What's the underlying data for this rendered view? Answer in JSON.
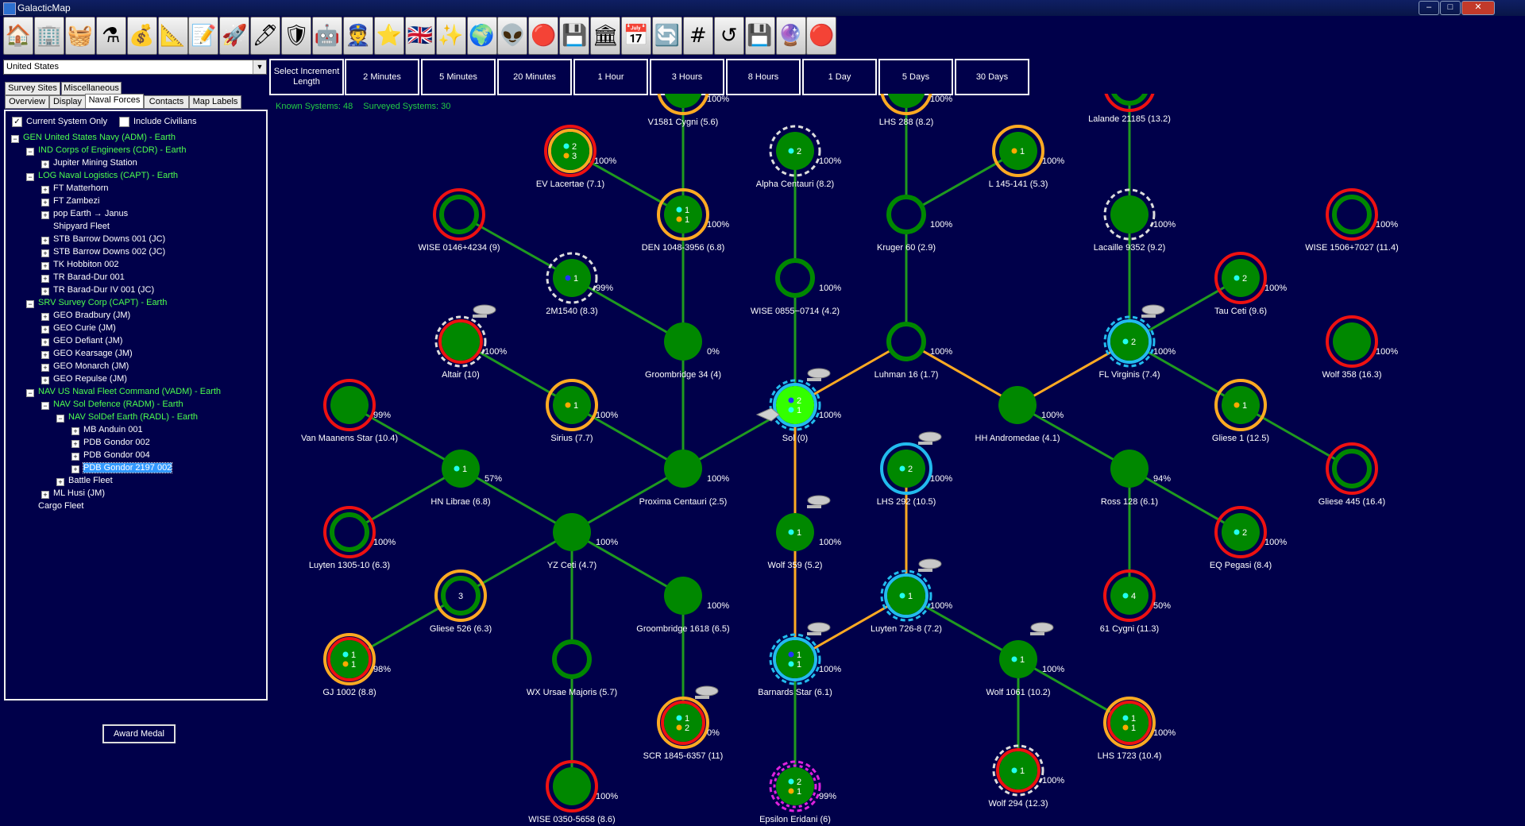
{
  "app": {
    "title": "GalacticMap"
  },
  "toolbar": [
    {
      "icon": "house-icon",
      "glyph": "🏠"
    },
    {
      "icon": "buildings-icon",
      "glyph": "🏢"
    },
    {
      "icon": "cargo-icon",
      "glyph": "🧺"
    },
    {
      "icon": "flask-icon",
      "glyph": "⚗"
    },
    {
      "icon": "money-bag-icon",
      "glyph": "💰"
    },
    {
      "icon": "blueprint-icon",
      "glyph": "📐"
    },
    {
      "icon": "document-icon",
      "glyph": "📝"
    },
    {
      "icon": "starship-icon",
      "glyph": "🚀"
    },
    {
      "icon": "missile-icon",
      "glyph": "🖊"
    },
    {
      "icon": "tank-icon",
      "glyph": "🛡"
    },
    {
      "icon": "walker-icon",
      "glyph": "🤖"
    },
    {
      "icon": "officer-icon",
      "glyph": "👮"
    },
    {
      "icon": "star-medal-icon",
      "glyph": "⭐"
    },
    {
      "icon": "union-jack-icon",
      "glyph": "🇬🇧"
    },
    {
      "icon": "system-map-icon",
      "glyph": "✨"
    },
    {
      "icon": "globe-icon",
      "glyph": "🌍"
    },
    {
      "icon": "alien-icon",
      "glyph": "👽"
    },
    {
      "icon": "red-eye-icon",
      "glyph": "🔴"
    },
    {
      "icon": "circuit-icon",
      "glyph": "💾"
    },
    {
      "icon": "capitol-icon",
      "glyph": "🏛"
    },
    {
      "icon": "calendar-icon",
      "glyph": "📅"
    },
    {
      "icon": "refresh-icon",
      "glyph": "🔄"
    },
    {
      "icon": "grid-icon",
      "glyph": "#"
    },
    {
      "icon": "undo-arrow-icon",
      "glyph": "↺"
    },
    {
      "icon": "save-icon",
      "glyph": "💾"
    },
    {
      "icon": "crystal-ball-icon",
      "glyph": "🔮"
    },
    {
      "icon": "red-button-icon",
      "glyph": "🔴"
    }
  ],
  "empire_select": {
    "value": "United States"
  },
  "tabs_row1": [
    "Survey Sites",
    "Miscellaneous"
  ],
  "tabs_row2": [
    "Overview",
    "Display",
    "Naval Forces",
    "Contacts",
    "Map Labels"
  ],
  "active_tab": "Naval Forces",
  "checkboxes": {
    "current_system_only": "Current System Only",
    "current_checked": "✓",
    "include_civilians": "Include Civilians"
  },
  "tree": [
    {
      "level": 0,
      "tog": "−",
      "text": "GEN United States Navy  (ADM)  -  Earth",
      "color": "#4dff4d"
    },
    {
      "level": 1,
      "tog": "−",
      "text": "IND Corps of Engineers  (CDR)  -  Earth",
      "color": "#4dff4d"
    },
    {
      "level": 2,
      "tog": "+",
      "text": "Jupiter Mining Station",
      "color": "#ffffff"
    },
    {
      "level": 1,
      "tog": "−",
      "text": "LOG Naval Logistics  (CAPT)  -  Earth",
      "color": "#4dff4d"
    },
    {
      "level": 2,
      "tog": "+",
      "text": "FT Matterhorn",
      "color": "#ffffff"
    },
    {
      "level": 2,
      "tog": "+",
      "text": "FT Zambezi",
      "color": "#ffffff"
    },
    {
      "level": 2,
      "tog": "+",
      "text": "pop Earth → Janus",
      "color": "#ffffff"
    },
    {
      "level": 2,
      "tog": "",
      "text": "Shipyard Fleet",
      "color": "#ffffff"
    },
    {
      "level": 2,
      "tog": "+",
      "text": "STB Barrow Downs 001  (JC)",
      "color": "#ffffff"
    },
    {
      "level": 2,
      "tog": "+",
      "text": "STB Barrow Downs 002  (JC)",
      "color": "#ffffff"
    },
    {
      "level": 2,
      "tog": "+",
      "text": "TK Hobbiton 002",
      "color": "#ffffff"
    },
    {
      "level": 2,
      "tog": "+",
      "text": "TR Barad-Dur 001",
      "color": "#ffffff"
    },
    {
      "level": 2,
      "tog": "+",
      "text": "TR Barad-Dur IV 001  (JC)",
      "color": "#ffffff"
    },
    {
      "level": 1,
      "tog": "−",
      "text": "SRV Survey Corp  (CAPT)  -  Earth",
      "color": "#4dff4d"
    },
    {
      "level": 2,
      "tog": "+",
      "text": "GEO Bradbury  (JM)",
      "color": "#ffffff"
    },
    {
      "level": 2,
      "tog": "+",
      "text": "GEO Curie  (JM)",
      "color": "#ffffff"
    },
    {
      "level": 2,
      "tog": "+",
      "text": "GEO Defiant  (JM)",
      "color": "#ffffff"
    },
    {
      "level": 2,
      "tog": "+",
      "text": "GEO Kearsage  (JM)",
      "color": "#ffffff"
    },
    {
      "level": 2,
      "tog": "+",
      "text": "GEO Monarch  (JM)",
      "color": "#ffffff"
    },
    {
      "level": 2,
      "tog": "+",
      "text": "GEO Repulse  (JM)",
      "color": "#ffffff"
    },
    {
      "level": 1,
      "tog": "−",
      "text": "NAV US Naval Fleet Command  (VADM)  -  Earth",
      "color": "#4dff4d"
    },
    {
      "level": 2,
      "tog": "−",
      "text": "NAV Sol Defence  (RADM)  -  Earth",
      "color": "#4dff4d"
    },
    {
      "level": 3,
      "tog": "−",
      "text": "NAV SolDef Earth  (RADL)  -  Earth",
      "color": "#4dff4d"
    },
    {
      "level": 4,
      "tog": "+",
      "text": "MB Anduin 001",
      "color": "#ffffff"
    },
    {
      "level": 4,
      "tog": "+",
      "text": "PDB Gondor 002",
      "color": "#ffffff"
    },
    {
      "level": 4,
      "tog": "+",
      "text": "PDB Gondor 004",
      "color": "#ffffff"
    },
    {
      "level": 4,
      "tog": "+",
      "text": "PDB Gondor 2197 002",
      "color": "#ffffff",
      "selected": true
    },
    {
      "level": 3,
      "tog": "+",
      "text": "Battle Fleet",
      "color": "#ffffff"
    },
    {
      "level": 2,
      "tog": "+",
      "text": "ML Husi  (JM)",
      "color": "#ffffff"
    },
    {
      "level": 1,
      "tog": "",
      "text": "Cargo Fleet",
      "color": "#ffffff"
    }
  ],
  "award_button": "Award Medal",
  "increments": [
    "Select Increment Length",
    "2 Minutes",
    "5 Minutes",
    "20 Minutes",
    "1 Hour",
    "3 Hours",
    "8 Hours",
    "1 Day",
    "5 Days",
    "30 Days"
  ],
  "stats": {
    "known": "Known Systems: 48",
    "surveyed": "Surveyed Systems: 30"
  },
  "colors": {
    "lane_green": "#1f9a1f",
    "lane_orange": "#ffaa22",
    "ring_red": "#ee1111",
    "ring_orange": "#ffaa22",
    "ring_white": "#dddddd",
    "ring_cyan": "#22bbee",
    "ring_magenta": "#dd22dd",
    "planet": "#008800"
  },
  "systems": [
    {
      "id": "v1581",
      "name": "V1581 Cygni  (5.6)",
      "pct": "100%",
      "ring": [
        "orange"
      ],
      "fill": true
    },
    {
      "id": "lhs288",
      "name": "LHS 288  (8.2)",
      "pct": "100%",
      "ring": [
        "orange"
      ],
      "fill": true
    },
    {
      "id": "lalande",
      "name": "Lalande 21185  (13.2)",
      "pct": "",
      "ring": [
        "red"
      ],
      "fill": false
    },
    {
      "id": "evlac",
      "name": "EV Lacertae  (7.1)",
      "pct": "100%",
      "ring": [
        "red",
        "orange"
      ],
      "fill": true,
      "dots": [
        {
          "c": "cyan",
          "n": "2"
        },
        {
          "c": "orange",
          "n": "3"
        }
      ]
    },
    {
      "id": "alphacen",
      "name": "Alpha Centauri  (8.2)",
      "pct": "100%",
      "ring": [
        "whitedash"
      ],
      "fill": true,
      "dots": [
        {
          "c": "cyan",
          "n": "2"
        }
      ]
    },
    {
      "id": "l145",
      "name": "L 145-141  (5.3)",
      "pct": "100%",
      "ring": [
        "orange"
      ],
      "fill": true,
      "dots": [
        {
          "c": "orange",
          "n": "1"
        }
      ]
    },
    {
      "id": "wise0146",
      "name": "WISE 0146+4234  (9)",
      "pct": "",
      "ring": [
        "red"
      ],
      "fill": false
    },
    {
      "id": "den1048",
      "name": "DEN 1048-3956  (6.8)",
      "pct": "100%",
      "ring": [
        "orange"
      ],
      "fill": true,
      "dots": [
        {
          "c": "cyan",
          "n": "1"
        },
        {
          "c": "orange",
          "n": "1"
        }
      ]
    },
    {
      "id": "kruger60",
      "name": "Kruger 60  (2.9)",
      "pct": "100%",
      "ring": [],
      "fill": false
    },
    {
      "id": "lacaille",
      "name": "Lacaille 9352  (9.2)",
      "pct": "100%",
      "ring": [
        "whitedash"
      ],
      "fill": true
    },
    {
      "id": "wise1506",
      "name": "WISE 1506+7027  (11.4)",
      "pct": "100%",
      "ring": [
        "red"
      ],
      "fill": false
    },
    {
      "id": "2m1540",
      "name": "2M1540  (8.3)",
      "pct": "99%",
      "ring": [
        "whitedash"
      ],
      "fill": true,
      "dots": [
        {
          "c": "blue",
          "n": "1"
        }
      ]
    },
    {
      "id": "wise0855",
      "name": "WISE 0855−0714  (4.2)",
      "pct": "100%",
      "ring": [],
      "fill": false
    },
    {
      "id": "tauceti",
      "name": "Tau Ceti  (9.6)",
      "pct": "100%",
      "ring": [
        "red"
      ],
      "fill": true,
      "dots": [
        {
          "c": "cyan",
          "n": "2"
        }
      ]
    },
    {
      "id": "altair",
      "name": "Altair  (10)",
      "pct": "100%",
      "ring": [
        "whitedash",
        "red"
      ],
      "fill": true,
      "ship": true
    },
    {
      "id": "groom34",
      "name": "Groombridge 34  (4)",
      "pct": "0%",
      "ring": [],
      "fill": true
    },
    {
      "id": "luhman16",
      "name": "Luhman 16  (1.7)",
      "pct": "100%",
      "ring": [],
      "fill": false
    },
    {
      "id": "flvirg",
      "name": "FL Virginis  (7.4)",
      "pct": "100%",
      "ring": [
        "cyandash",
        "cyan"
      ],
      "fill": true,
      "dots": [
        {
          "c": "cyan",
          "n": "2"
        }
      ],
      "ship": true
    },
    {
      "id": "wolf358",
      "name": "Wolf 358  (16.3)",
      "pct": "100%",
      "ring": [
        "red"
      ],
      "fill": true
    },
    {
      "id": "vanmaanen",
      "name": "Van Maanens Star  (10.4)",
      "pct": "99%",
      "ring": [
        "red"
      ],
      "fill": true
    },
    {
      "id": "sirius",
      "name": "Sirius  (7.7)",
      "pct": "100%",
      "ring": [
        "orange"
      ],
      "fill": true,
      "dots": [
        {
          "c": "orange",
          "n": "1"
        }
      ]
    },
    {
      "id": "sol",
      "name": "Sol  (0)",
      "pct": "100%",
      "ring": [
        "cyandash",
        "cyan"
      ],
      "fill": true,
      "sun": true,
      "dots": [
        {
          "c": "blue",
          "n": "2"
        },
        {
          "c": "cyan",
          "n": "1"
        }
      ],
      "ship": true
    },
    {
      "id": "hhandro",
      "name": "HH Andromedae  (4.1)",
      "pct": "100%",
      "ring": [],
      "fill": true
    },
    {
      "id": "gliese1",
      "name": "Gliese 1  (12.5)",
      "pct": "",
      "ring": [
        "orange"
      ],
      "fill": true,
      "dots": [
        {
          "c": "orange",
          "n": "1"
        }
      ]
    },
    {
      "id": "hnlibrae",
      "name": "HN Librae  (6.8)",
      "pct": "57%",
      "ring": [],
      "fill": true,
      "dots": [
        {
          "c": "cyan",
          "n": "1"
        }
      ]
    },
    {
      "id": "proxima",
      "name": "Proxima Centauri  (2.5)",
      "pct": "100%",
      "ring": [],
      "fill": true
    },
    {
      "id": "lhs292",
      "name": "LHS 292  (10.5)",
      "pct": "100%",
      "ring": [
        "cyan"
      ],
      "fill": true,
      "dots": [
        {
          "c": "cyan",
          "n": "2"
        }
      ],
      "ship": true
    },
    {
      "id": "ross128",
      "name": "Ross 128  (6.1)",
      "pct": "94%",
      "ring": [],
      "fill": true
    },
    {
      "id": "gliese445",
      "name": "Gliese 445  (16.4)",
      "pct": "",
      "ring": [
        "red"
      ],
      "fill": false
    },
    {
      "id": "luyten1305",
      "name": "Luyten 1305-10  (6.3)",
      "pct": "100%",
      "ring": [
        "red"
      ],
      "fill": false
    },
    {
      "id": "yzceti",
      "name": "YZ Ceti  (4.7)",
      "pct": "100%",
      "ring": [],
      "fill": true
    },
    {
      "id": "wolf359",
      "name": "Wolf 359  (5.2)",
      "pct": "100%",
      "ring": [],
      "fill": true,
      "dots": [
        {
          "c": "cyan",
          "n": "1"
        }
      ],
      "ship": true
    },
    {
      "id": "eqpeg",
      "name": "EQ Pegasi  (8.4)",
      "pct": "100%",
      "ring": [
        "red"
      ],
      "fill": true,
      "dots": [
        {
          "c": "cyan",
          "n": "2"
        }
      ]
    },
    {
      "id": "gliese526",
      "name": "Gliese 526  (6.3)",
      "pct": "",
      "ring": [
        "orange"
      ],
      "fill": false,
      "dots": [
        {
          "c": "none",
          "n": "3"
        }
      ]
    },
    {
      "id": "groom1618",
      "name": "Groombridge 1618  (6.5)",
      "pct": "100%",
      "ring": [],
      "fill": true
    },
    {
      "id": "luyten726",
      "name": "Luyten 726-8  (7.2)",
      "pct": "100%",
      "ring": [
        "cyandash",
        "cyan"
      ],
      "fill": true,
      "dots": [
        {
          "c": "cyan",
          "n": "1"
        }
      ],
      "ship": true
    },
    {
      "id": "61cyg",
      "name": "61 Cygni  (11.3)",
      "pct": "50%",
      "ring": [
        "red"
      ],
      "fill": true,
      "dots": [
        {
          "c": "cyan",
          "n": "4"
        }
      ]
    },
    {
      "id": "gj1002",
      "name": "GJ 1002  (8.8)",
      "pct": "98%",
      "ring": [
        "orange",
        "red"
      ],
      "fill": true,
      "dots": [
        {
          "c": "cyan",
          "n": "1"
        },
        {
          "c": "orange",
          "n": "1"
        }
      ]
    },
    {
      "id": "wxursae",
      "name": "WX Ursae Majoris  (5.7)",
      "pct": "",
      "ring": [],
      "fill": false
    },
    {
      "id": "barnard",
      "name": "Barnards Star  (6.1)",
      "pct": "100%",
      "ring": [
        "cyandash",
        "cyan"
      ],
      "fill": true,
      "dots": [
        {
          "c": "blue",
          "n": "1"
        },
        {
          "c": "cyan",
          "n": "1"
        }
      ],
      "ship": true
    },
    {
      "id": "wolf1061",
      "name": "Wolf 1061  (10.2)",
      "pct": "100%",
      "ring": [],
      "fill": true,
      "dots": [
        {
          "c": "cyan",
          "n": "1"
        }
      ],
      "ship": true
    },
    {
      "id": "scr1845",
      "name": "SCR 1845-6357  (11)",
      "pct": "0%",
      "ring": [
        "orange",
        "red"
      ],
      "fill": true,
      "dots": [
        {
          "c": "cyan",
          "n": "1"
        },
        {
          "c": "orange",
          "n": "2"
        }
      ],
      "ship": true
    },
    {
      "id": "lhs1723",
      "name": "LHS 1723  (10.4)",
      "pct": "100%",
      "ring": [
        "orange",
        "red"
      ],
      "fill": true,
      "dots": [
        {
          "c": "cyan",
          "n": "1"
        },
        {
          "c": "orange",
          "n": "1"
        }
      ]
    },
    {
      "id": "wise0350",
      "name": "WISE 0350-5658  (8.6)",
      "pct": "100%",
      "ring": [
        "red"
      ],
      "fill": true
    },
    {
      "id": "epseri",
      "name": "Epsilon Eridani  (6)",
      "pct": "99%",
      "ring": [
        "magentadash",
        "magentadash2",
        "orange"
      ],
      "fill": true,
      "dots": [
        {
          "c": "cyan",
          "n": "2"
        },
        {
          "c": "orange",
          "n": "1"
        }
      ]
    },
    {
      "id": "wolf294",
      "name": "Wolf 294  (12.3)",
      "pct": "100%",
      "ring": [
        "whitedash",
        "red"
      ],
      "fill": true,
      "dots": [
        {
          "c": "cyan",
          "n": "1"
        }
      ]
    }
  ],
  "lanes": [
    {
      "a": "v1581",
      "b": "den1048",
      "c": "green"
    },
    {
      "a": "evlac",
      "b": "den1048",
      "c": "green"
    },
    {
      "a": "den1048",
      "b": "groom34",
      "c": "green"
    },
    {
      "a": "groom34",
      "b": "proxima",
      "c": "green"
    },
    {
      "a": "alphacen",
      "b": "wise0855",
      "c": "green"
    },
    {
      "a": "wise0855",
      "b": "sol",
      "c": "green"
    },
    {
      "a": "lhs288",
      "b": "kruger60",
      "c": "green"
    },
    {
      "a": "kruger60",
      "b": "luhman16",
      "c": "green"
    },
    {
      "a": "l145",
      "b": "kruger60",
      "c": "green"
    },
    {
      "a": "luhman16",
      "b": "sol",
      "c": "orange"
    },
    {
      "a": "luhman16",
      "b": "hhandro",
      "c": "orange"
    },
    {
      "a": "hhandro",
      "b": "flvirg",
      "c": "orange"
    },
    {
      "a": "lalande",
      "b": "lacaille",
      "c": "green"
    },
    {
      "a": "lacaille",
      "b": "flvirg",
      "c": "green"
    },
    {
      "a": "tauceti",
      "b": "flvirg",
      "c": "green"
    },
    {
      "a": "flvirg",
      "b": "gliese1",
      "c": "green"
    },
    {
      "a": "gliese1",
      "b": "gliese445",
      "c": "green"
    },
    {
      "a": "hhandro",
      "b": "ross128",
      "c": "green"
    },
    {
      "a": "ross128",
      "b": "eqpeg",
      "c": "green"
    },
    {
      "a": "ross128",
      "b": "61cyg",
      "c": "green"
    },
    {
      "a": "wise0146",
      "b": "2m1540",
      "c": "green"
    },
    {
      "a": "2m1540",
      "b": "groom34",
      "c": "green"
    },
    {
      "a": "altair",
      "b": "sirius",
      "c": "green"
    },
    {
      "a": "sirius",
      "b": "proxima",
      "c": "green"
    },
    {
      "a": "proxima",
      "b": "sol",
      "c": "green"
    },
    {
      "a": "proxima",
      "b": "yzceti",
      "c": "green"
    },
    {
      "a": "vanmaanen",
      "b": "hnlibrae",
      "c": "green"
    },
    {
      "a": "hnlibrae",
      "b": "yzceti",
      "c": "green"
    },
    {
      "a": "hnlibrae",
      "b": "luyten1305",
      "c": "green"
    },
    {
      "a": "yzceti",
      "b": "gliese526",
      "c": "green"
    },
    {
      "a": "gliese526",
      "b": "gj1002",
      "c": "green"
    },
    {
      "a": "yzceti",
      "b": "wxursae",
      "c": "green"
    },
    {
      "a": "wxursae",
      "b": "wise0350",
      "c": "green"
    },
    {
      "a": "yzceti",
      "b": "groom1618",
      "c": "green"
    },
    {
      "a": "groom1618",
      "b": "scr1845",
      "c": "green"
    },
    {
      "a": "sol",
      "b": "wolf359",
      "c": "orange"
    },
    {
      "a": "wolf359",
      "b": "barnard",
      "c": "orange"
    },
    {
      "a": "barnard",
      "b": "epseri",
      "c": "green"
    },
    {
      "a": "barnard",
      "b": "luyten726",
      "c": "orange"
    },
    {
      "a": "lhs292",
      "b": "luyten726",
      "c": "orange"
    },
    {
      "a": "luyten726",
      "b": "wolf1061",
      "c": "green"
    },
    {
      "a": "wolf1061",
      "b": "lhs1723",
      "c": "green"
    },
    {
      "a": "wolf1061",
      "b": "wolf294",
      "c": "green"
    }
  ]
}
